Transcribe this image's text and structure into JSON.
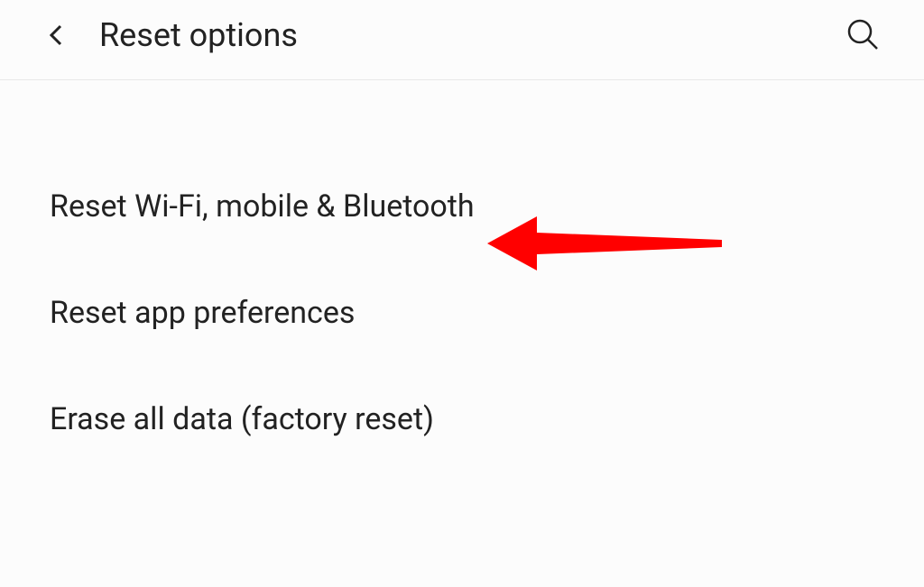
{
  "header": {
    "title": "Reset options"
  },
  "options": [
    {
      "label": "Reset Wi-Fi, mobile & Bluetooth"
    },
    {
      "label": "Reset app preferences"
    },
    {
      "label": "Erase all data (factory reset)"
    }
  ]
}
